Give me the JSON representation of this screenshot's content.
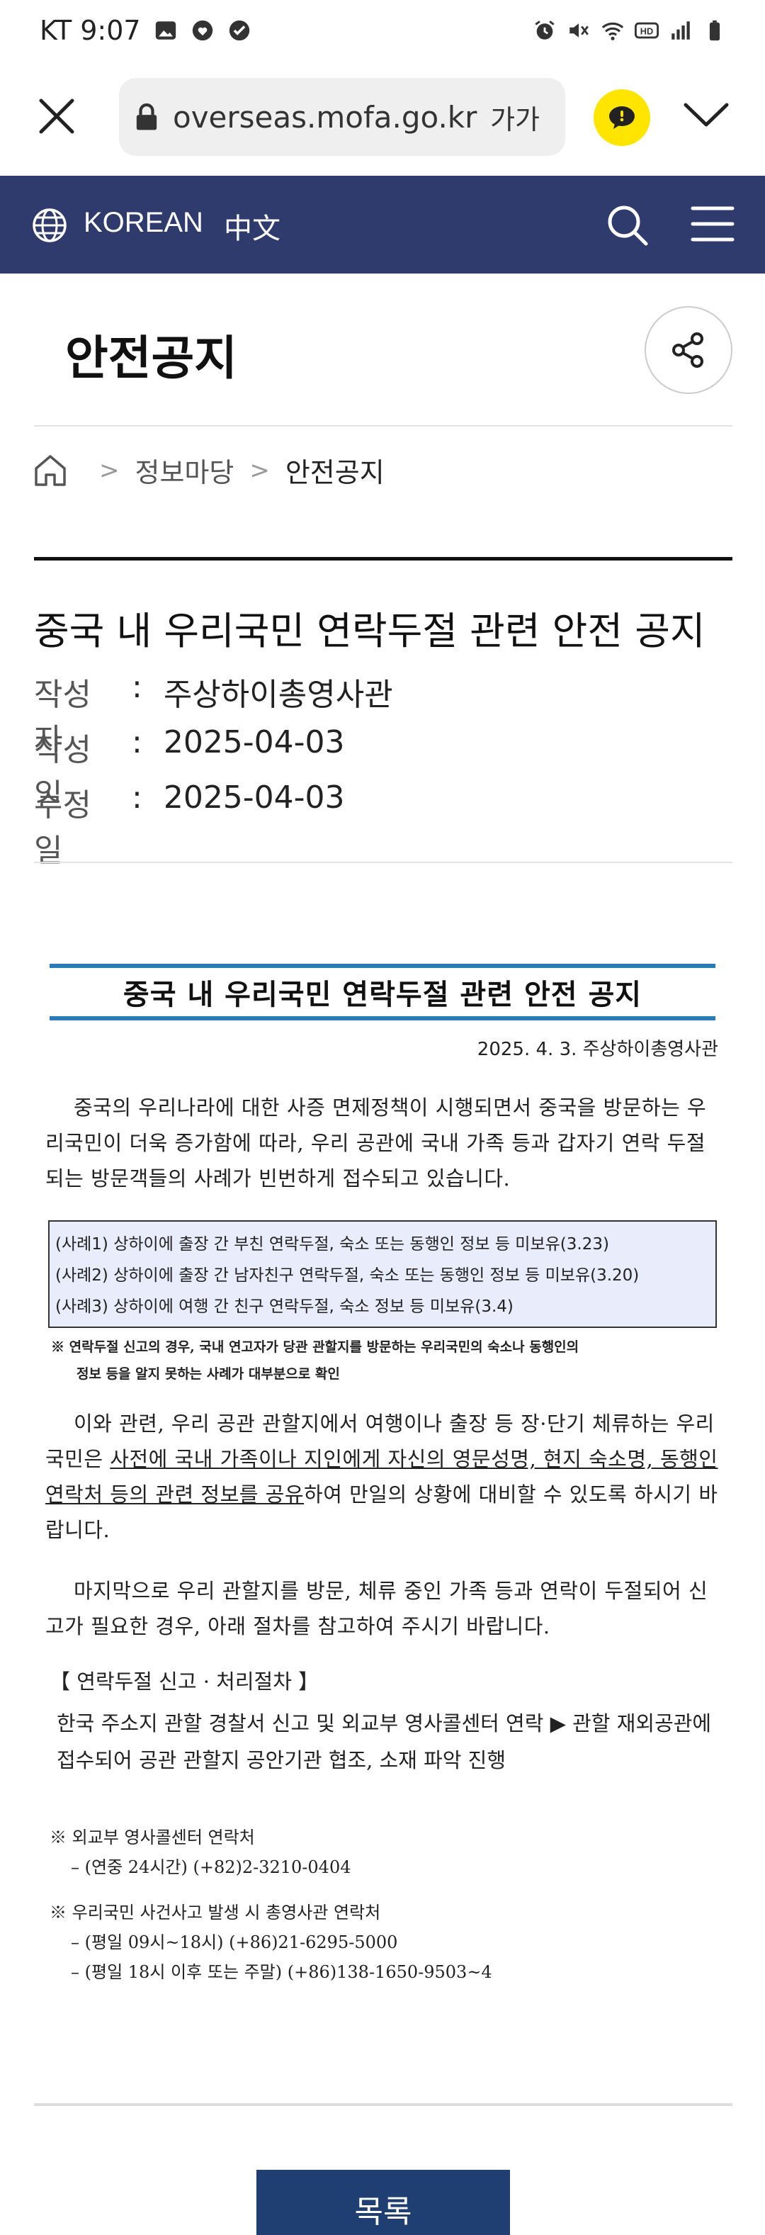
{
  "status_bar": {
    "carrier_time": "KT 9:07"
  },
  "browser": {
    "url": "overseas.mofa.go.kr",
    "font_size_label": "가가"
  },
  "site_header": {
    "lang_korean": "KOREAN",
    "lang_chinese": "中文",
    "background": "#2f3b6c"
  },
  "page": {
    "title": "안전공지"
  },
  "breadcrumb": {
    "items": [
      "정보마당",
      "안전공지"
    ]
  },
  "article": {
    "title": "중국 내 우리국민 연락두절 관련 안전 공지",
    "meta": [
      {
        "label": "작성자",
        "value": "주상하이총영사관"
      },
      {
        "label": "작성일",
        "value": "2025-04-03"
      },
      {
        "label": "수정일",
        "value": "2025-04-03"
      }
    ]
  },
  "notice": {
    "title": "중국 내 우리국민 연락두절 관련 안전 공지",
    "date_line": "2025. 4. 3.  주상하이총영사관",
    "para1": "중국의 우리나라에 대한 사증 면제정책이 시행되면서 중국을 방문하는 우리국민이 더욱 증가함에 따라, 우리 공관에 국내 가족 등과 갑자기 연락 두절되는 방문객들의 사례가 빈번하게 접수되고 있습니다.",
    "cases": [
      "(사례1) 상하이에 출장 간 부친 연락두절, 숙소 또는 동행인 정보 등 미보유(3.23)",
      "(사례2) 상하이에 출장 간 남자친구 연락두절, 숙소 또는 동행인 정보 등 미보유(3.20)",
      "(사례3) 상하이에 여행 간 친구 연락두절, 숙소 정보 등 미보유(3.4)"
    ],
    "note_line1": "※ 연락두절 신고의 경우, 국내 연고자가 당관 관할지를 방문하는 우리국민의 숙소나 동행인의",
    "note_line2": "정보 등을 알지 못하는 사례가 대부분으로 확인",
    "para2_a": "이와 관련, 우리 공관 관할지에서 여행이나 출장 등 장·단기 체류하는 우리국민은 ",
    "para2_u": "사전에 국내 가족이나 지인에게 자신의 영문성명, 현지 숙소명, 동행인 연락처 등의 관련 정보를 공유",
    "para2_b": "하여 만일의 상황에 대비할 수 있도록 하시기 바랍니다.",
    "para3": "마지막으로 우리 관할지를 방문, 체류 중인 가족 등과 연락이 두절되어 신고가 필요한 경우, 아래 절차를 참고하여 주시기 바랍니다.",
    "proc_title": "【 연락두절 신고 · 처리절차 】",
    "proc_body": "한국 주소지 관할 경찰서 신고 및 외교부 영사콜센터 연락 ▶ 관할 재외공관에 접수되어 공관 관할지 공안기관 협조, 소재 파악 진행",
    "contact1_title": "※ 외교부 영사콜센터 연락처",
    "contact1_line": "– (연중 24시간) (+82)2-3210-0404",
    "contact2_title": "※ 우리국민 사건사고 발생 시 총영사관 연락처",
    "contact2_line1": "– (평일 09시~18시) (+86)21-6295-5000",
    "contact2_line2": "– (평일 18시 이후 또는 주말) (+86)138-1650-9503~4"
  },
  "footer": {
    "list_button": "목록"
  }
}
